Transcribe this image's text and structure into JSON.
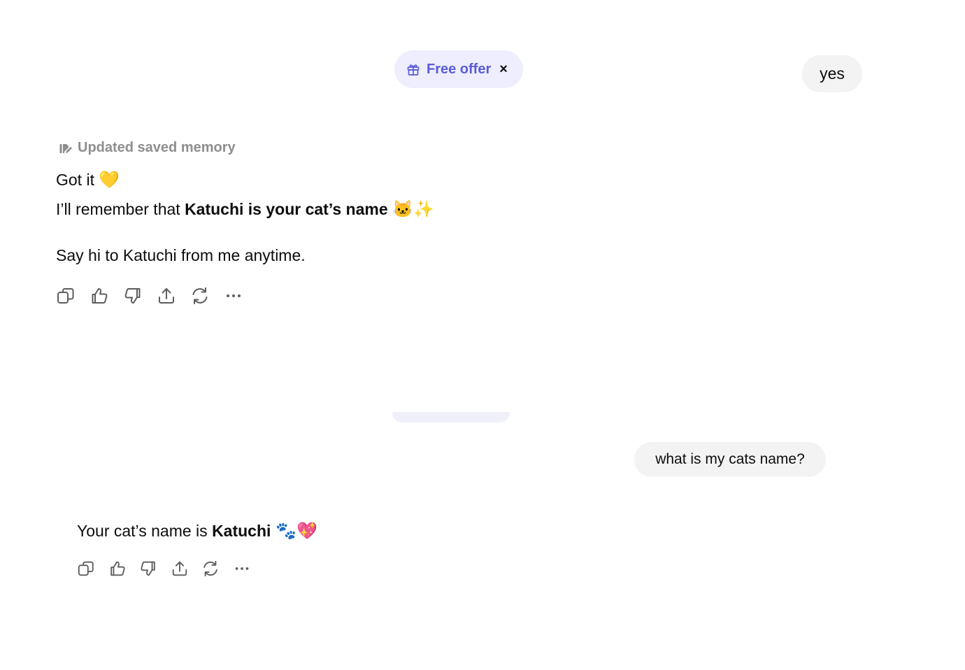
{
  "offer": {
    "label": "Free offer",
    "close": "×",
    "accent_color": "#5b5bd6",
    "icon": "gift-icon"
  },
  "messages": {
    "user_1": "yes",
    "memory_status": "Updated saved memory",
    "assistant_1": {
      "line1_text": "Got it ",
      "line1_emoji": "💛",
      "line2_prefix": "I’ll remember that ",
      "line2_bold": "Katuchi is your cat’s name",
      "line2_emoji": " 🐱✨",
      "line3": "Say hi to Katuchi from me anytime."
    },
    "user_2": "what is my cats name?",
    "assistant_2": {
      "prefix": "Your cat’s name is ",
      "bold": "Katuchi",
      "emoji": " 🐾💖"
    }
  },
  "actions": [
    {
      "name": "copy",
      "icon": "copy-icon"
    },
    {
      "name": "thumbs-up",
      "icon": "thumbs-up-icon"
    },
    {
      "name": "thumbs-down",
      "icon": "thumbs-down-icon"
    },
    {
      "name": "share",
      "icon": "share-icon"
    },
    {
      "name": "regenerate",
      "icon": "refresh-icon"
    },
    {
      "name": "more",
      "icon": "more-icon"
    }
  ]
}
